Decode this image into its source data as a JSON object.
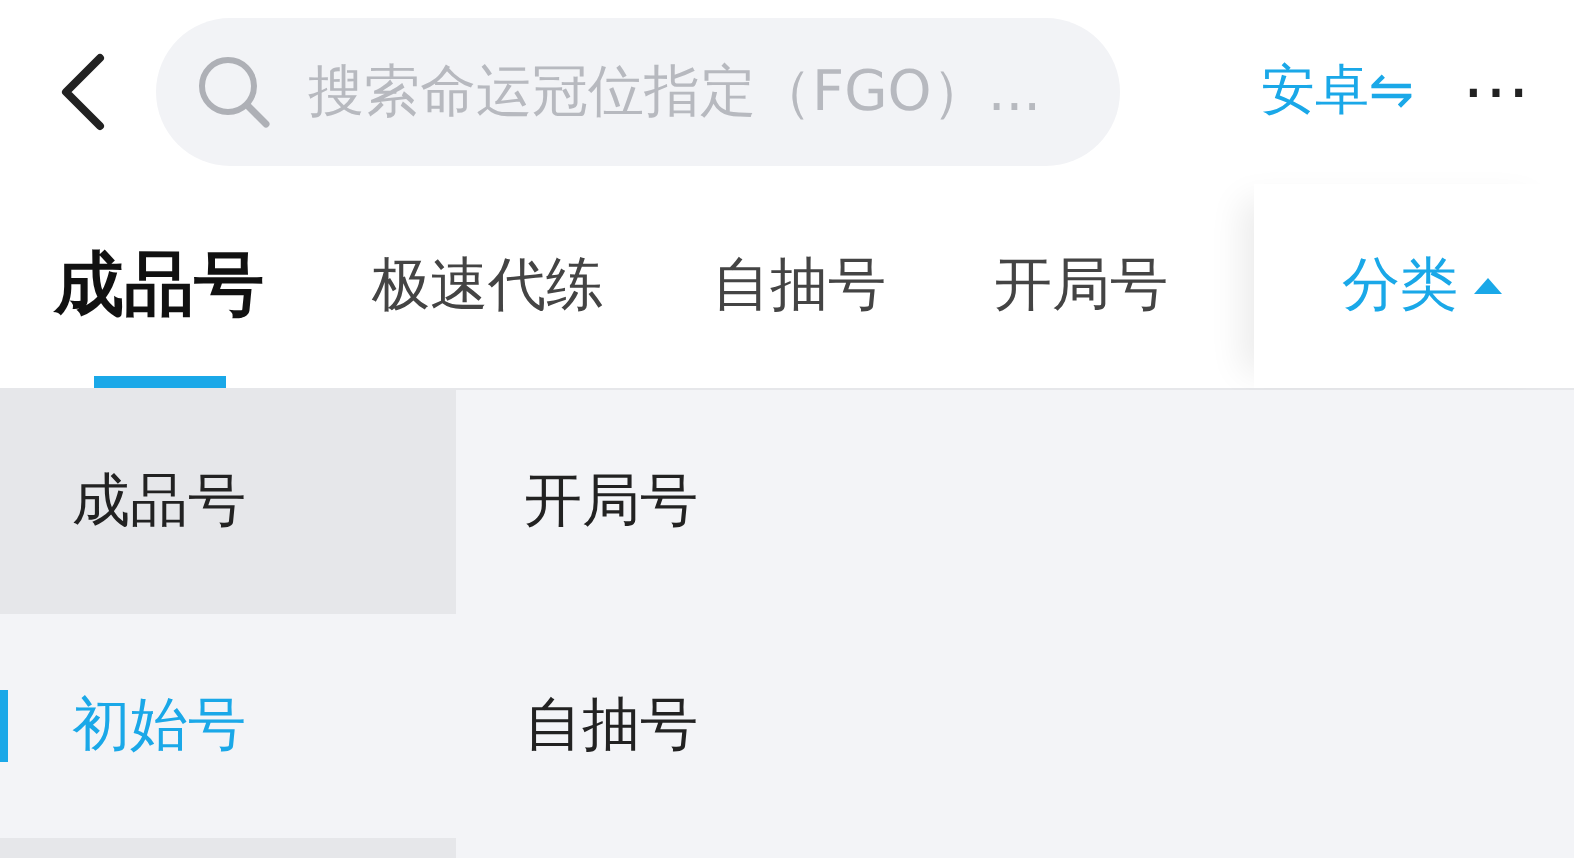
{
  "search": {
    "placeholder": "搜索命运冠位指定（FGO）..."
  },
  "platform": {
    "label": "安卓",
    "icon": "⇋"
  },
  "more": "⋯",
  "tabs": [
    {
      "label": "成品号",
      "selected": true
    },
    {
      "label": "极速代练",
      "selected": false
    },
    {
      "label": "自抽号",
      "selected": false
    },
    {
      "label": "开局号",
      "selected": false
    }
  ],
  "category_toggle": {
    "label": "分类",
    "expanded": true
  },
  "sidebar": {
    "items": [
      {
        "label": "成品号",
        "selected": false
      },
      {
        "label": "初始号",
        "selected": true
      },
      {
        "selected": false
      }
    ]
  },
  "content": {
    "items": [
      "开局号",
      "自抽号"
    ]
  }
}
